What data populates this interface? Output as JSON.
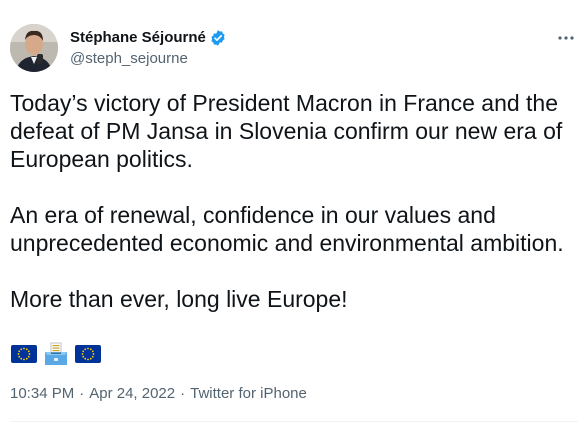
{
  "author": {
    "display_name": "Stéphane Séjourné",
    "handle": "@steph_sejourne"
  },
  "tweet": {
    "paragraphs": [
      "Today’s victory of President Macron in France and the defeat of PM Jansa in Slovenia confirm our new era of European politics.",
      "An era of renewal, confidence in our values and unprecedented economic and environmental ambition.",
      "More than ever, long live Europe!"
    ],
    "emojis": [
      "eu-flag-icon",
      "ballot-box-icon",
      "eu-flag-icon"
    ]
  },
  "meta": {
    "time": "10:34 PM",
    "date": "Apr 24, 2022",
    "source": "Twitter for iPhone",
    "separator": "·"
  },
  "colors": {
    "verified": "#1d9bf0",
    "secondary_text": "#536471",
    "eu_blue": "#003399",
    "eu_gold": "#ffcc00"
  }
}
